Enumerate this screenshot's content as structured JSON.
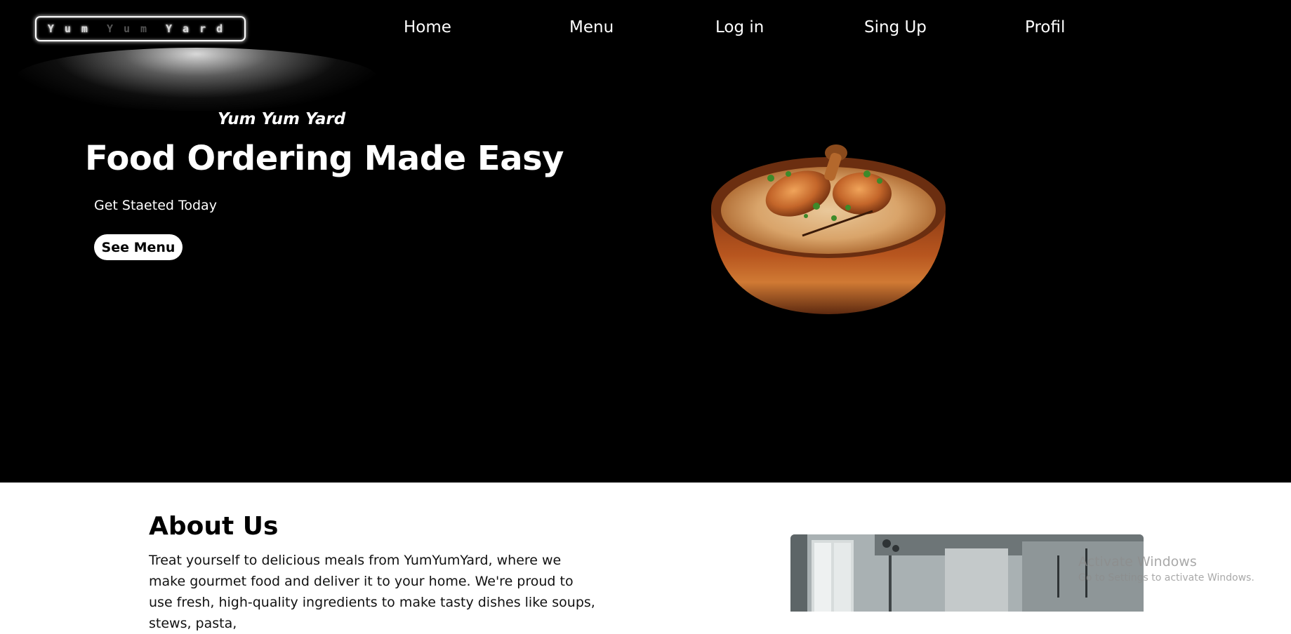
{
  "brand": {
    "logo_parts": [
      "Yum",
      "Yum",
      "Yard"
    ]
  },
  "nav": {
    "items": [
      {
        "label": "Home"
      },
      {
        "label": "Menu"
      },
      {
        "label": "Log in"
      },
      {
        "label": "Sing Up"
      },
      {
        "label": "Profil"
      }
    ]
  },
  "hero": {
    "subtitle": "Yum Yum Yard",
    "title": "Food Ordering Made Easy",
    "tagline": "Get Staeted Today",
    "cta_label": "See Menu",
    "image": "biryani-bowl-image"
  },
  "about": {
    "title": "About Us",
    "text": "Treat yourself to delicious meals from YumYumYard, where we make gourmet food and deliver it to your home. We're proud to use fresh, high-quality ingredients to make tasty dishes like soups, stews, pasta,",
    "image": "restaurant-kitchen-image"
  },
  "os_watermark": {
    "line1": "Activate Windows",
    "line2": "Go to Settings to activate Windows."
  },
  "colors": {
    "hero_bg": "#000000",
    "page_bg": "#ffffff",
    "cta_bg": "#ffffff",
    "text_light": "#ffffff",
    "text_dark": "#000000"
  }
}
